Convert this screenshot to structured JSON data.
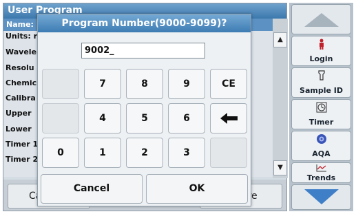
{
  "background": {
    "title": "User Program",
    "name_row": "Name:",
    "rows": [
      "Units: r",
      "Wavele",
      "Resolu",
      "Chemic",
      "Calibra",
      "Upper",
      "Lower",
      "Timer 1",
      "Timer 2"
    ],
    "bottom_left": "Ca",
    "bottom_right": "ore"
  },
  "side_panel": {
    "login": "Login",
    "sample_id": "Sample ID",
    "timer": "Timer",
    "aqa": "AQA",
    "trends": "Trends"
  },
  "dialog": {
    "title": "Program Number(9000-9099)?",
    "input_value": "9002_",
    "keys": {
      "k7": "7",
      "k8": "8",
      "k9": "9",
      "ce": "CE",
      "k4": "4",
      "k5": "5",
      "k6": "6",
      "k0": "0",
      "k1": "1",
      "k2": "2",
      "k3": "3"
    },
    "cancel": "Cancel",
    "ok": "OK"
  },
  "icons": [
    "backspace-arrow-icon",
    "scroll-up-icon",
    "scroll-down-icon",
    "login-icon",
    "sample-id-icon",
    "timer-icon",
    "aqa-icon",
    "trends-icon",
    "nav-up-icon",
    "nav-down-icon"
  ]
}
